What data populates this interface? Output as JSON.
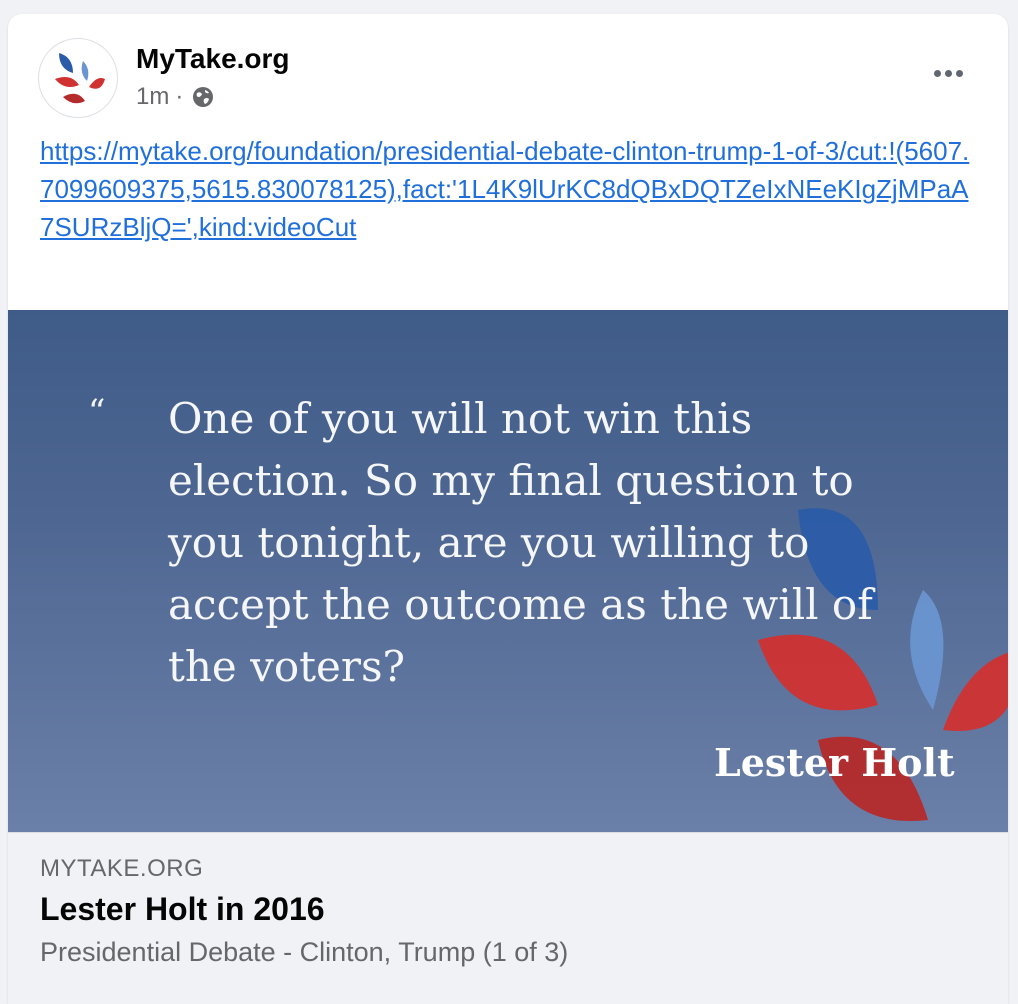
{
  "post": {
    "page_name": "MyTake.org",
    "timestamp": "1m",
    "separator": "·",
    "audience_icon": "globe-icon",
    "more_icon": "more-options-icon",
    "link_url": "https://mytake.org/foundation/presidential-debate-clinton-trump-1-of-3/cut:!(5607.7099609375,5615.830078125),fact:'1L4K9lUrKC8dQBxDQTZeIxNEeKIgZjMPaA7SURzBljQ=',kind:videoCut"
  },
  "preview_image": {
    "quote_mark": "“",
    "quote": "One of you will not win this election. So my final question to you tonight, are you willing to accept the outcome as the will of the voters?",
    "speaker": "Lester Holt",
    "colors": {
      "background": "#4e6792",
      "leaf_blue": "#2a5ba8",
      "leaf_light_blue": "#6a95d0",
      "leaf_red": "#d03232"
    }
  },
  "link_preview": {
    "domain": "MYTAKE.ORG",
    "title": "Lester Holt in 2016",
    "description": "Presidential Debate - Clinton, Trump (1 of 3)"
  }
}
